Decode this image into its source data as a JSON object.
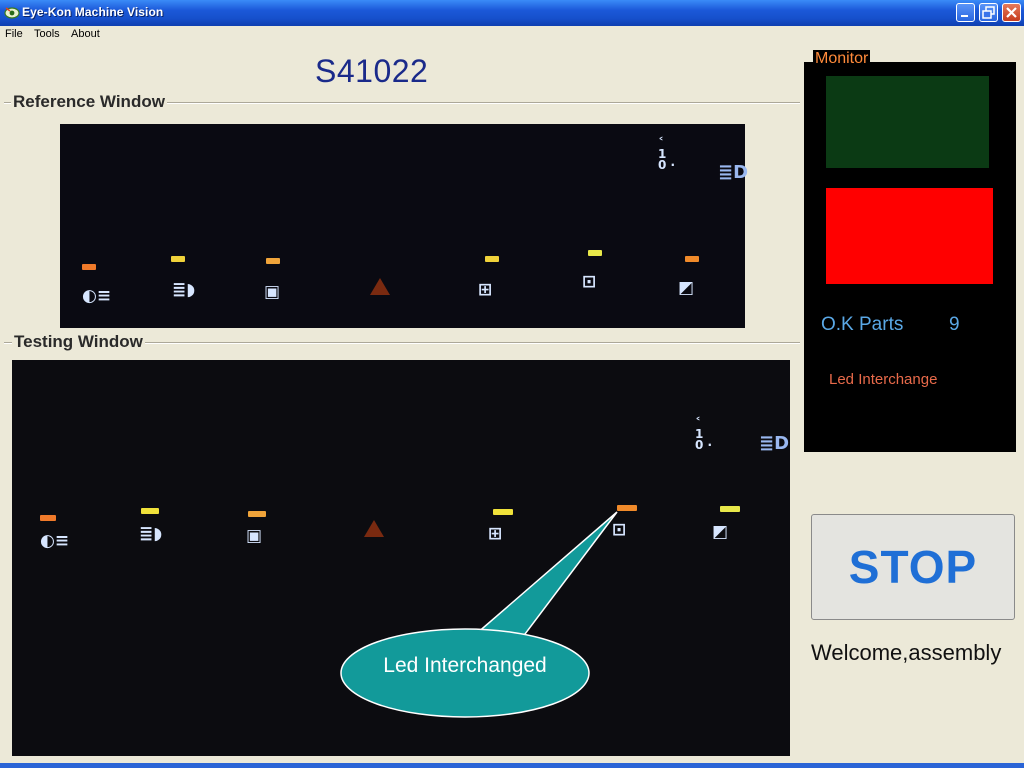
{
  "window": {
    "title": "Eye-Kon Machine Vision",
    "icon": "eye-kon-logo-icon"
  },
  "menu": {
    "items": [
      "File",
      "Tools",
      "About"
    ]
  },
  "job": {
    "code": "S41022"
  },
  "reference_window": {
    "label": "Reference Window"
  },
  "testing_window": {
    "label": "Testing Window"
  },
  "monitor": {
    "label": "Monitor",
    "status_colors": {
      "ok": "#0b3a14",
      "fail": "#ff0000"
    },
    "ok_parts_label": "O.K Parts",
    "ok_parts_count": "9",
    "message": "Led Interchange"
  },
  "controls": {
    "stop_label": "STOP"
  },
  "user": {
    "welcome": "Welcome,assembly"
  },
  "annotation": {
    "callout_text": "Led Interchanged",
    "callout_color": "#129a9a"
  }
}
